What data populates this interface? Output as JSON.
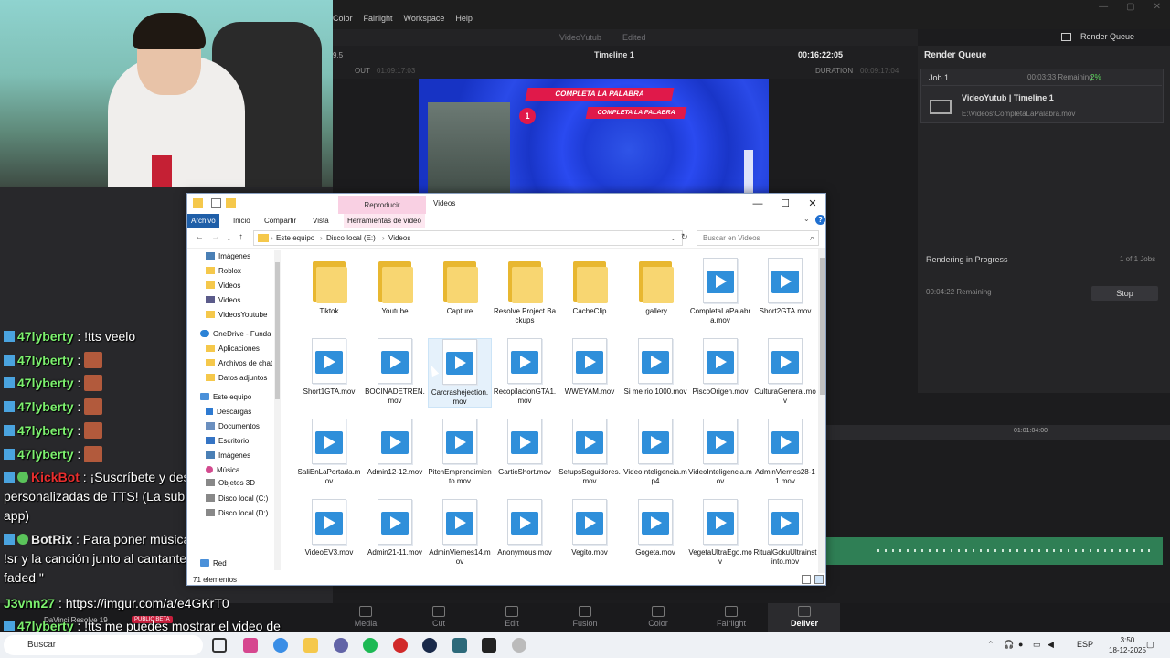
{
  "resolve": {
    "menu": [
      "Color",
      "Fairlight",
      "Workspace",
      "Help"
    ],
    "project_name": "VideoYutub",
    "project_status": "Edited",
    "viewer": {
      "tc_left": "9.5",
      "timeline_name": "Timeline 1",
      "timecode": "00:16:22:05",
      "out_label": "OUT",
      "out_tc": "01:09:17:03",
      "duration_label": "DURATION",
      "duration_tc": "00:09:17:04",
      "frame_banner": "COMPLETA LA PALABRA",
      "frame_banner2": "COMPLETA LA PALABRA",
      "frame_number": "1"
    },
    "render_queue": {
      "title": "Render Queue",
      "button": "Render Queue",
      "job_name": "Job 1",
      "job_remaining": "00:03:33 Remaining",
      "job_percent": "2%",
      "job_title": "VideoYutub | Timeline 1",
      "job_path": "E:\\Videos\\CompletaLaPalabra.mov",
      "status": "Rendering in Progress",
      "count": "1 of 1 Jobs",
      "remaining": "00:04:22 Remaining",
      "stop": "Stop"
    },
    "timeline_tc": "01:01:04:00",
    "pages": [
      "Media",
      "Cut",
      "Edit",
      "Fusion",
      "Color",
      "Fairlight",
      "Deliver"
    ],
    "brand": "DaVinci Resolve 19",
    "beta": "PUBLIC BETA"
  },
  "chat": [
    {
      "user": "47lyberty",
      "text": ": !tts veelo"
    },
    {
      "user": "47lyberty",
      "text": ":"
    },
    {
      "user": "47lyberty",
      "text": ":"
    },
    {
      "user": "47lyberty",
      "text": ":"
    },
    {
      "user": "47lyberty",
      "text": ":"
    },
    {
      "user": "47lyberty",
      "text": ":"
    }
  ],
  "chat_long": {
    "kickbot_user": "KickBot",
    "kickbot_text": ": ¡Suscríbete y desbloquea las voces personalizadas de TTS! (La sub es más cara en la app)",
    "botrix_user": "BotRix",
    "botrix_text": ": Para poner música escribe en el chat !sr y la canción junto al cantante EJ: !sr alan walker faded \"",
    "j3_user": "J3vnn27",
    "j3_text": ": https://imgur.com/a/e4GKrT0",
    "last_user": "47lyberty",
    "last_text": ": !tts me puedes mostrar el video de reaccionando arboles"
  },
  "explorer": {
    "reproducir": "Reproducir",
    "title": "Videos",
    "tabs": [
      "Archivo",
      "Inicio",
      "Compartir",
      "Vista",
      "Herramientas de vídeo"
    ],
    "breadcrumb": [
      "Este equipo",
      "Disco local (E:)",
      "Videos"
    ],
    "search_placeholder": "Buscar en Videos",
    "nav": [
      {
        "label": "Imágenes",
        "icon": "img"
      },
      {
        "label": "Roblox",
        "icon": "folder"
      },
      {
        "label": "Videos",
        "icon": "folder"
      },
      {
        "label": "Videos",
        "icon": "vid"
      },
      {
        "label": "VideosYoutube",
        "icon": "folder"
      },
      {
        "label": "OneDrive - Funda",
        "icon": "cloud"
      },
      {
        "label": "Aplicaciones",
        "icon": "folder"
      },
      {
        "label": "Archivos de chat",
        "icon": "folder"
      },
      {
        "label": "Datos adjuntos",
        "icon": "folder"
      },
      {
        "label": "Este equipo",
        "icon": "pc"
      },
      {
        "label": "Descargas",
        "icon": "down"
      },
      {
        "label": "Documentos",
        "icon": "doc"
      },
      {
        "label": "Escritorio",
        "icon": "desk"
      },
      {
        "label": "Imágenes",
        "icon": "img"
      },
      {
        "label": "Música",
        "icon": "music"
      },
      {
        "label": "Objetos 3D",
        "icon": "gray"
      },
      {
        "label": "Disco local (C:)",
        "icon": "gray"
      },
      {
        "label": "Disco local (D:)",
        "icon": "gray"
      },
      {
        "label": "Red",
        "icon": "pc"
      }
    ],
    "items": [
      {
        "name": "Tiktok",
        "type": "folder"
      },
      {
        "name": "Youtube",
        "type": "folder"
      },
      {
        "name": "Capture",
        "type": "folder"
      },
      {
        "name": "Resolve Project Backups",
        "type": "folder"
      },
      {
        "name": "CacheClip",
        "type": "folder"
      },
      {
        "name": ".gallery",
        "type": "folder"
      },
      {
        "name": "CompletaLaPalabra.mov",
        "type": "video"
      },
      {
        "name": "Short2GTA.mov",
        "type": "video"
      },
      {
        "name": "Short1GTA.mov",
        "type": "video"
      },
      {
        "name": "BOCINADETREN.mov",
        "type": "video"
      },
      {
        "name": "Carcrashejection.mov",
        "type": "video"
      },
      {
        "name": "RecopilacionGTA1.mov",
        "type": "video"
      },
      {
        "name": "WWEYAM.mov",
        "type": "video"
      },
      {
        "name": "Si me rio 1000.mov",
        "type": "video"
      },
      {
        "name": "PiscoOrigen.mov",
        "type": "video"
      },
      {
        "name": "CulturaGeneral.mov",
        "type": "video"
      },
      {
        "name": "SaliEnLaPortada.mov",
        "type": "video"
      },
      {
        "name": "Admin12-12.mov",
        "type": "video"
      },
      {
        "name": "PitchEmprendimiento.mov",
        "type": "video"
      },
      {
        "name": "GarticShort.mov",
        "type": "video"
      },
      {
        "name": "SetupsSeguidores.mov",
        "type": "video"
      },
      {
        "name": "VideoInteligencia.mp4",
        "type": "video"
      },
      {
        "name": "VideoInteligencia.mov",
        "type": "video"
      },
      {
        "name": "AdminViernes28-11.mov",
        "type": "video"
      },
      {
        "name": "VideoEV3.mov",
        "type": "video"
      },
      {
        "name": "Admin21-11.mov",
        "type": "video"
      },
      {
        "name": "AdminViernes14.mov",
        "type": "video"
      },
      {
        "name": "Anonymous.mov",
        "type": "video"
      },
      {
        "name": "Vegito.mov",
        "type": "video"
      },
      {
        "name": "Gogeta.mov",
        "type": "video"
      },
      {
        "name": "VegetaUltraEgo.mov",
        "type": "video"
      },
      {
        "name": "RitualGokuUltrainstinto.mov",
        "type": "video"
      }
    ],
    "status": "71 elementos"
  },
  "taskbar": {
    "search": "Buscar",
    "lang": "ESP",
    "time": "3:50",
    "date": "18-12-2025"
  }
}
